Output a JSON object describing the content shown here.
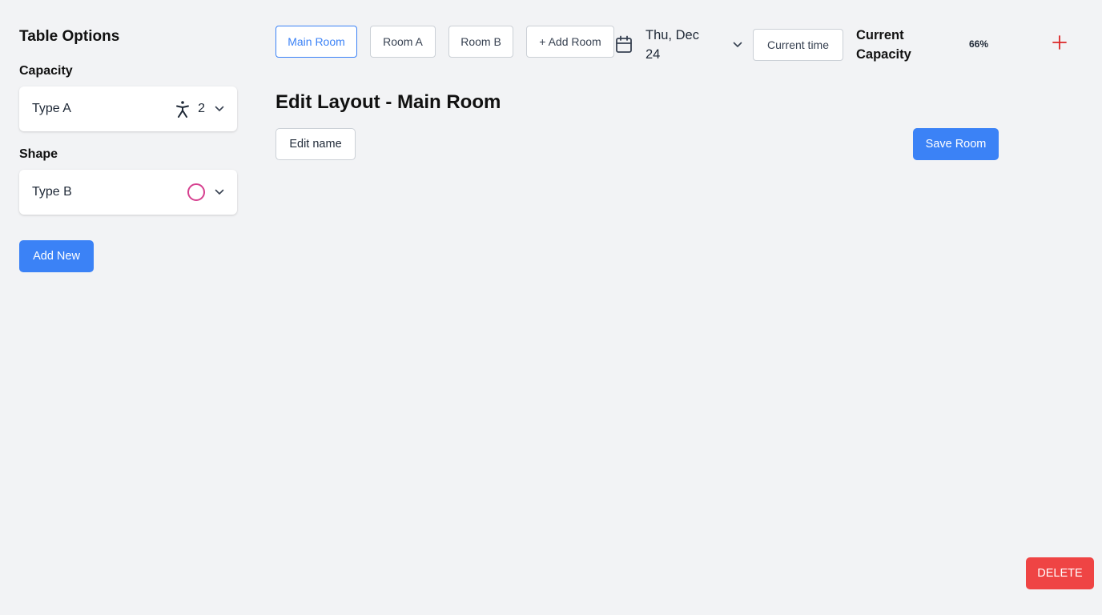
{
  "sidebar": {
    "title": "Table Options",
    "capacity": {
      "label": "Capacity",
      "value": "Type A",
      "icon": "person-icon",
      "count": "2"
    },
    "shape": {
      "label": "Shape",
      "value": "Type B",
      "icon": "circle-shape-icon"
    },
    "add_new_label": "Add New"
  },
  "header": {
    "rooms": [
      {
        "label": "Main Room",
        "active": true
      },
      {
        "label": "Room A",
        "active": false
      },
      {
        "label": "Room B",
        "active": false
      },
      {
        "label": "+ Add Room",
        "active": false
      }
    ],
    "date": "Thu, Dec 24",
    "current_time_label": "Current time",
    "capacity_label": "Current Capacity",
    "capacity_value": "66%"
  },
  "main": {
    "title": "Edit Layout - Main Room",
    "edit_name_label": "Edit name",
    "save_label": "Save Room",
    "delete_label": "DELETE"
  },
  "colors": {
    "accent": "#3b82f6",
    "danger": "#ef4444",
    "shape_outline": "#d6408f",
    "background": "#f2f3f5"
  }
}
